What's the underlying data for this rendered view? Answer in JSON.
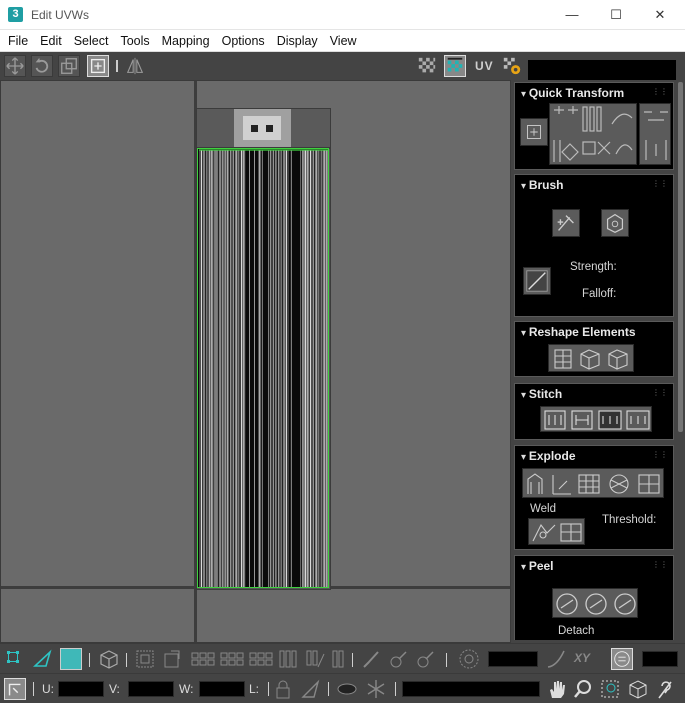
{
  "window": {
    "title": "Edit UVWs",
    "app_icon_glyph": "3",
    "minimize_glyph": "—",
    "maximize_glyph": "☐",
    "close_glyph": "✕"
  },
  "menu": [
    "File",
    "Edit",
    "Select",
    "Tools",
    "Mapping",
    "Options",
    "Display",
    "View"
  ],
  "toolbar": {
    "uv_label": "UV"
  },
  "panel": {
    "quick_transform": {
      "title": "Quick Transform"
    },
    "brush": {
      "title": "Brush",
      "strength_label": "Strength:",
      "falloff_label": "Falloff:"
    },
    "reshape": {
      "title": "Reshape Elements"
    },
    "stitch": {
      "title": "Stitch"
    },
    "explode": {
      "title": "Explode",
      "weld_label": "Weld",
      "threshold_label": "Threshold:"
    },
    "peel": {
      "title": "Peel",
      "detach_label": "Detach"
    }
  },
  "bottom": {
    "u_label": "U:",
    "v_label": "V:",
    "w_label": "W:",
    "l_label": "L:",
    "xy_label": "XY"
  },
  "colors": {
    "selection_swatch": "#3fb8b8",
    "uv_edge": "#3fd13f"
  }
}
